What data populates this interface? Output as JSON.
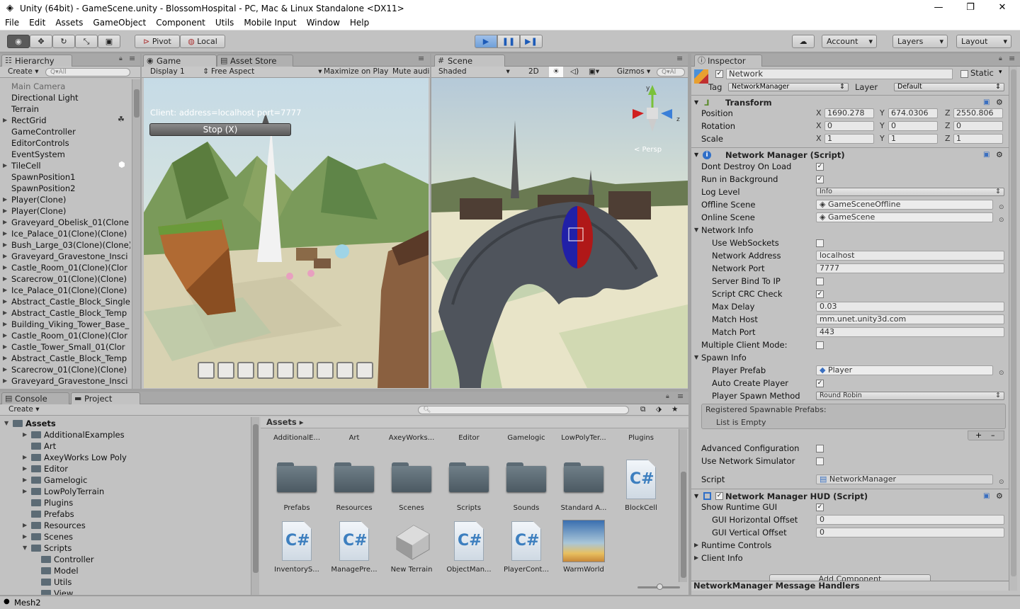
{
  "window": {
    "title": "Unity (64bit) - GameScene.unity - BlossomHospital - PC, Mac & Linux Standalone <DX11>",
    "minimize": "—",
    "maximize": "❐",
    "close": "✕"
  },
  "menu": [
    "File",
    "Edit",
    "Assets",
    "GameObject",
    "Component",
    "Utils",
    "Mobile Input",
    "Window",
    "Help"
  ],
  "toolbar": {
    "pivot": "Pivot",
    "local": "Local",
    "account": "Account",
    "layers": "Layers",
    "layout": "Layout"
  },
  "hierarchy": {
    "tab": "Hierarchy",
    "create": "Create",
    "search_placeholder": "Q▾All",
    "items": [
      {
        "label": "Main Camera",
        "grey": true
      },
      {
        "label": "Directional Light",
        "grey": false
      },
      {
        "label": "Terrain",
        "grey": false
      },
      {
        "label": "RectGrid",
        "grey": false,
        "fold": true
      },
      {
        "label": "GameController",
        "grey": false
      },
      {
        "label": "EditorControls",
        "grey": false
      },
      {
        "label": "EventSystem",
        "grey": false
      },
      {
        "label": "TileCell",
        "grey": false,
        "fold": true
      },
      {
        "label": "SpawnPosition1",
        "grey": false
      },
      {
        "label": "SpawnPosition2",
        "grey": false
      },
      {
        "label": "Player(Clone)",
        "grey": false,
        "fold": true
      },
      {
        "label": "Player(Clone)",
        "grey": false,
        "fold": true
      },
      {
        "label": "Graveyard_Obelisk_01(Clone",
        "grey": false,
        "fold": true
      },
      {
        "label": "Ice_Palace_01(Clone)(Clone)",
        "grey": false,
        "fold": true
      },
      {
        "label": "Bush_Large_03(Clone)(Clone)",
        "grey": false,
        "fold": true
      },
      {
        "label": "Graveyard_Gravestone_Insci",
        "grey": false,
        "fold": true
      },
      {
        "label": "Castle_Room_01(Clone)(Clor",
        "grey": false,
        "fold": true
      },
      {
        "label": "Scarecrow_01(Clone)(Clone)",
        "grey": false,
        "fold": true
      },
      {
        "label": "Ice_Palace_01(Clone)(Clone)",
        "grey": false,
        "fold": true
      },
      {
        "label": "Abstract_Castle_Block_Single",
        "grey": false,
        "fold": true
      },
      {
        "label": "Abstract_Castle_Block_Temp",
        "grey": false,
        "fold": true
      },
      {
        "label": "Building_Viking_Tower_Base_",
        "grey": false,
        "fold": true
      },
      {
        "label": "Castle_Room_01(Clone)(Clor",
        "grey": false,
        "fold": true
      },
      {
        "label": "Castle_Tower_Small_01(Clor",
        "grey": false,
        "fold": true
      },
      {
        "label": "Abstract_Castle_Block_Temp",
        "grey": false,
        "fold": true
      },
      {
        "label": "Scarecrow_01(Clone)(Clone)",
        "grey": false,
        "fold": true
      },
      {
        "label": "Graveyard_Gravestone_Insci",
        "grey": false,
        "fold": true
      }
    ]
  },
  "game": {
    "tab": "Game",
    "asset_store_tab": "Asset Store",
    "display": "Display 1",
    "aspect": "Free Aspect",
    "maximize": "Maximize on Play",
    "mute": "Mute audi",
    "client_text": "Client: address=localhost port=7777",
    "stop_button": "Stop (X)",
    "hotbar_slots": 9
  },
  "scene": {
    "tab": "Scene",
    "shading": "Shaded",
    "mode_2d": "2D",
    "gizmos": "Gizmos",
    "search": "Q▾Al",
    "persp": "< Persp"
  },
  "inspector": {
    "tab": "Inspector",
    "name": "Network",
    "static": "Static",
    "tag_label": "Tag",
    "tag": "NetworkManager",
    "layer_label": "Layer",
    "layer": "Default",
    "transform": {
      "title": "Transform",
      "position_label": "Position",
      "position": {
        "x": "1690.278",
        "y": "674.0306",
        "z": "2550.806"
      },
      "rotation_label": "Rotation",
      "rotation": {
        "x": "0",
        "y": "0",
        "z": "0"
      },
      "scale_label": "Scale",
      "scale": {
        "x": "1",
        "y": "1",
        "z": "1"
      }
    },
    "nm": {
      "title": "Network Manager (Script)",
      "dont_destroy": "Dont Destroy On Load",
      "run_bg": "Run in Background",
      "log_level": "Log Level",
      "log_level_val": "Info",
      "offline_scene": "Offline Scene",
      "offline_scene_val": "GameSceneOffline",
      "online_scene": "Online Scene",
      "online_scene_val": "GameScene",
      "network_info": "Network Info",
      "use_websockets": "Use WebSockets",
      "network_address": "Network Address",
      "network_address_val": "localhost",
      "network_port": "Network Port",
      "network_port_val": "7777",
      "server_bind": "Server Bind To IP",
      "script_crc": "Script CRC Check",
      "max_delay": "Max Delay",
      "max_delay_val": "0.03",
      "match_host": "Match Host",
      "match_host_val": "mm.unet.unity3d.com",
      "match_port": "Match Port",
      "match_port_val": "443",
      "multiple_client": "Multiple Client Mode:",
      "spawn_info": "Spawn Info",
      "player_prefab": "Player Prefab",
      "player_prefab_val": "Player",
      "auto_create": "Auto Create Player",
      "spawn_method": "Player Spawn Method",
      "spawn_method_val": "Round Robin",
      "registered": "Registered Spawnable Prefabs:",
      "list_empty": "List is Empty",
      "advanced": "Advanced Configuration",
      "use_sim": "Use Network Simulator",
      "script": "Script",
      "script_val": "NetworkManager"
    },
    "hud": {
      "title": "Network Manager HUD (Script)",
      "show_gui": "Show Runtime GUI",
      "h_offset": "GUI Horizontal Offset",
      "h_offset_val": "0",
      "v_offset": "GUI Vertical Offset",
      "v_offset_val": "0",
      "runtime_controls": "Runtime Controls",
      "client_info": "Client Info"
    },
    "add_component": "Add Component",
    "footer": "NetworkManager Message Handlers"
  },
  "project": {
    "console_tab": "Console",
    "project_tab": "Project",
    "create": "Create",
    "tree": [
      {
        "label": "Assets",
        "level": 0,
        "open": true,
        "bold": true
      },
      {
        "label": "AdditionalExamples",
        "level": 1,
        "fold": true
      },
      {
        "label": "Art",
        "level": 1
      },
      {
        "label": "AxeyWorks Low Poly",
        "level": 1,
        "fold": true
      },
      {
        "label": "Editor",
        "level": 1,
        "fold": true
      },
      {
        "label": "Gamelogic",
        "level": 1,
        "fold": true
      },
      {
        "label": "LowPolyTerrain",
        "level": 1,
        "fold": true
      },
      {
        "label": "Plugins",
        "level": 1
      },
      {
        "label": "Prefabs",
        "level": 1
      },
      {
        "label": "Resources",
        "level": 1,
        "fold": true
      },
      {
        "label": "Scenes",
        "level": 1,
        "fold": true
      },
      {
        "label": "Scripts",
        "level": 1,
        "open": true
      },
      {
        "label": "Controller",
        "level": 2
      },
      {
        "label": "Model",
        "level": 2
      },
      {
        "label": "Utils",
        "level": 2
      },
      {
        "label": "View",
        "level": 2
      }
    ],
    "breadcrumb": "Assets ▸",
    "top_names": [
      "AdditionalE...",
      "Art",
      "AxeyWorks...",
      "Editor",
      "Gamelogic",
      "LowPolyTer...",
      "Plugins"
    ],
    "row1": [
      {
        "name": "Prefabs",
        "kind": "folder"
      },
      {
        "name": "Resources",
        "kind": "folder"
      },
      {
        "name": "Scenes",
        "kind": "folder"
      },
      {
        "name": "Scripts",
        "kind": "folder"
      },
      {
        "name": "Sounds",
        "kind": "folder"
      },
      {
        "name": "Standard A...",
        "kind": "folder"
      },
      {
        "name": "BlockCell",
        "kind": "cs"
      }
    ],
    "row2": [
      {
        "name": "InventoryS...",
        "kind": "cs"
      },
      {
        "name": "ManagePre...",
        "kind": "cs"
      },
      {
        "name": "New Terrain",
        "kind": "terrain"
      },
      {
        "name": "ObjectMan...",
        "kind": "cs"
      },
      {
        "name": "PlayerCont...",
        "kind": "cs"
      },
      {
        "name": "WarmWorld",
        "kind": "sky"
      }
    ]
  },
  "status": {
    "text": "Mesh2"
  },
  "colors": {
    "play_blue": "#3b7ddd",
    "panel": "#c2c2c2",
    "selection": "#3e7bd6"
  }
}
